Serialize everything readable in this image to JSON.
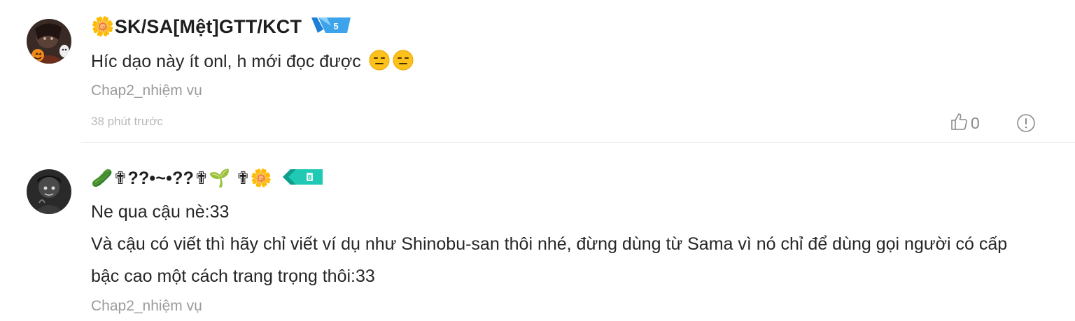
{
  "comments": [
    {
      "username": "🌼SK/SA[Mệt]GTT/KCT",
      "level": "5",
      "text": "Híc dạo này ít onl, h mới đọc được",
      "chapter": "Chap2_nhiệm vụ",
      "time": "38 phút trước",
      "likes": "0",
      "icons": [
        "avatar",
        "level-badge-blue",
        "expressionless-emoji",
        "thumbs-up-icon",
        "report-icon"
      ]
    },
    {
      "username": "🥒✟??•~•??✟🌱 ✟🌼",
      "level": "8",
      "text_lines": [
        "Ne qua cậu nè:33",
        "Và cậu có viết thì hãy chỉ viết ví dụ như Shinobu-san thôi nhé, đừng dùng từ Sama vì nó chỉ để dùng gọi người có cấp",
        "bậc cao một cách trang trọng thôi:33"
      ],
      "chapter": "Chap2_nhiệm vụ",
      "icons": [
        "avatar",
        "level-badge-teal"
      ]
    }
  ],
  "colors": {
    "level_badge_blue": "#3da4ec",
    "level_badge_teal": "#1fc9b4",
    "chapter_text": "#9a9a9a",
    "time_text": "#b9b9b9",
    "divider": "#ececec"
  }
}
